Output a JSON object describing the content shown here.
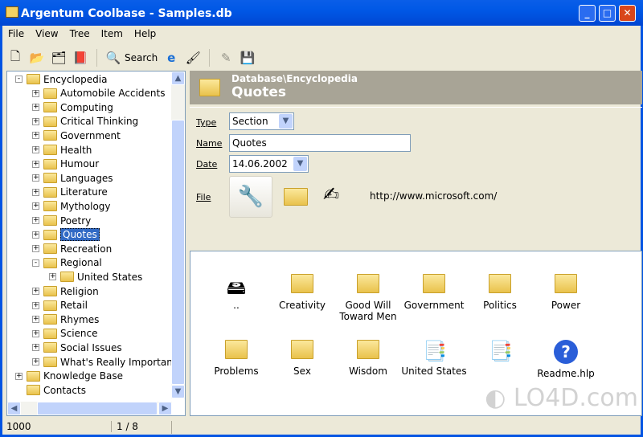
{
  "window": {
    "title": "Argentum Coolbase - Samples.db"
  },
  "menu": [
    "File",
    "View",
    "Tree",
    "Item",
    "Help"
  ],
  "toolbar": {
    "search_label": "Search"
  },
  "tree": [
    {
      "label": "Encyclopedia",
      "level": 0,
      "state": "-"
    },
    {
      "label": "Automobile Accidents",
      "level": 1,
      "state": "+"
    },
    {
      "label": "Computing",
      "level": 1,
      "state": "+"
    },
    {
      "label": "Critical Thinking",
      "level": 1,
      "state": "+"
    },
    {
      "label": "Government",
      "level": 1,
      "state": "+"
    },
    {
      "label": "Health",
      "level": 1,
      "state": "+"
    },
    {
      "label": "Humour",
      "level": 1,
      "state": "+"
    },
    {
      "label": "Languages",
      "level": 1,
      "state": "+"
    },
    {
      "label": "Literature",
      "level": 1,
      "state": "+"
    },
    {
      "label": "Mythology",
      "level": 1,
      "state": "+"
    },
    {
      "label": "Poetry",
      "level": 1,
      "state": "+"
    },
    {
      "label": "Quotes",
      "level": 1,
      "state": "+",
      "selected": true
    },
    {
      "label": "Recreation",
      "level": 1,
      "state": "+"
    },
    {
      "label": "Regional",
      "level": 1,
      "state": "-"
    },
    {
      "label": "United States",
      "level": 2,
      "state": "+"
    },
    {
      "label": "Religion",
      "level": 1,
      "state": "+"
    },
    {
      "label": "Retail",
      "level": 1,
      "state": "+"
    },
    {
      "label": "Rhymes",
      "level": 1,
      "state": "+"
    },
    {
      "label": "Science",
      "level": 1,
      "state": "+"
    },
    {
      "label": "Social Issues",
      "level": 1,
      "state": "+"
    },
    {
      "label": "What's Really Important",
      "level": 1,
      "state": "+"
    },
    {
      "label": "Knowledge Base",
      "level": 0,
      "state": "+"
    },
    {
      "label": "Contacts",
      "level": 0,
      "state": ""
    }
  ],
  "header": {
    "path": "Database\\Encyclopedia",
    "title": "Quotes"
  },
  "form": {
    "type_label": "Type",
    "type_value": "Section",
    "name_label": "Name",
    "name_value": "Quotes",
    "date_label": "Date",
    "date_value": "14.06.2002",
    "file_label": "File",
    "file_url": "http://www.microsoft.com/"
  },
  "items": [
    {
      "label": "..",
      "icon": "drive"
    },
    {
      "label": "Creativity",
      "icon": "folder"
    },
    {
      "label": "Good Will Toward Men",
      "icon": "folder"
    },
    {
      "label": "Government",
      "icon": "folder"
    },
    {
      "label": "Politics",
      "icon": "folder"
    },
    {
      "label": "Power",
      "icon": "folder"
    },
    {
      "label": "Problems",
      "icon": "folder"
    },
    {
      "label": "Sex",
      "icon": "folder"
    },
    {
      "label": "Wisdom",
      "icon": "folder"
    },
    {
      "label": "United States",
      "icon": "documents"
    },
    {
      "label": "",
      "icon": "documents"
    },
    {
      "label": "Readme.hlp",
      "icon": "help"
    }
  ],
  "status": {
    "count": "1000",
    "position": "1 / 8"
  },
  "watermark": "LO4D.com"
}
